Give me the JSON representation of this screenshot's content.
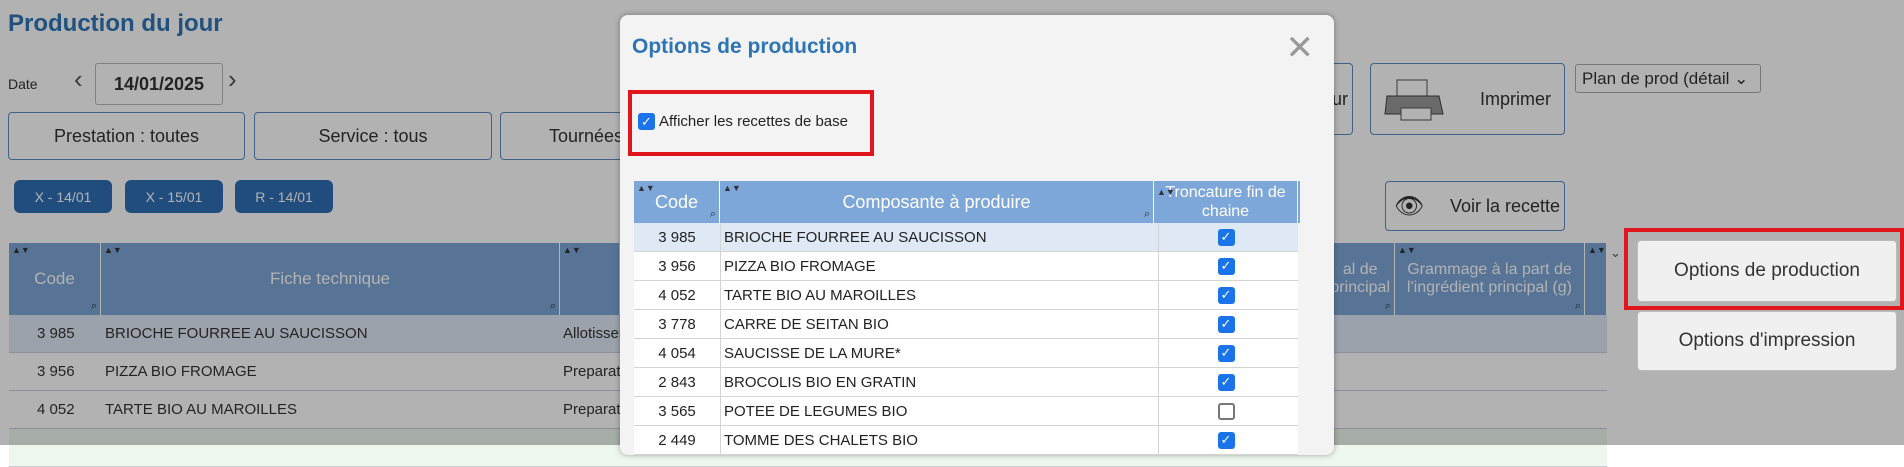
{
  "page": {
    "title": "Production du jour",
    "date_label": "Date",
    "date_value": "14/01/2025",
    "filters": {
      "prestation": "Prestation : toutes",
      "service": "Service : tous",
      "tournees": "Tournées"
    },
    "pills": [
      "X - 14/01",
      "X - 15/01",
      "R - 14/01"
    ],
    "buttons": {
      "partial_r": "ur",
      "print": "Imprimer",
      "view_recipe": "Voir la recette",
      "production_options": "Options de production",
      "print_options": "Options d'impression"
    },
    "plan_select": "Plan de prod (détail",
    "table": {
      "headers": {
        "code": "Code",
        "fiche": "Fiche technique",
        "total_partial": "al de principal",
        "grammage": "Grammage à la part de l'ingrédient principal (g)"
      },
      "rows": [
        {
          "code": "3 985",
          "fiche": "BRIOCHE FOURREE AU SAUCISSON",
          "step": "Allotisser"
        },
        {
          "code": "3 956",
          "fiche": "PIZZA BIO FROMAGE",
          "step": "Preparat"
        },
        {
          "code": "4 052",
          "fiche": "TARTE BIO AU MAROILLES",
          "step": "Preparat"
        }
      ]
    }
  },
  "dialog": {
    "title": "Options de production",
    "show_base_recipes": {
      "label": "Afficher les recettes de base",
      "checked": true
    },
    "table": {
      "headers": {
        "code": "Code",
        "component": "Composante à produire",
        "truncation": "Troncature fin de chaine"
      },
      "rows": [
        {
          "code": "3 985",
          "name": "BRIOCHE FOURREE AU SAUCISSON",
          "checked": true
        },
        {
          "code": "3 956",
          "name": "PIZZA BIO FROMAGE",
          "checked": true
        },
        {
          "code": "4 052",
          "name": "TARTE BIO AU MAROILLES",
          "checked": true
        },
        {
          "code": "3 778",
          "name": "CARRE DE SEITAN BIO",
          "checked": true
        },
        {
          "code": "4 054",
          "name": "SAUCISSE DE LA MURE*",
          "checked": true
        },
        {
          "code": "2 843",
          "name": "BROCOLIS BIO EN GRATIN",
          "checked": true
        },
        {
          "code": "3 565",
          "name": "POTEE DE LEGUMES BIO",
          "checked": false
        },
        {
          "code": "2 449",
          "name": "TOMME DES CHALETS BIO",
          "checked": true
        }
      ]
    }
  },
  "colors": {
    "accent": "#2e75b6",
    "header": "#7da7d9",
    "highlight": "#e0161c",
    "check": "#1a73e8"
  }
}
